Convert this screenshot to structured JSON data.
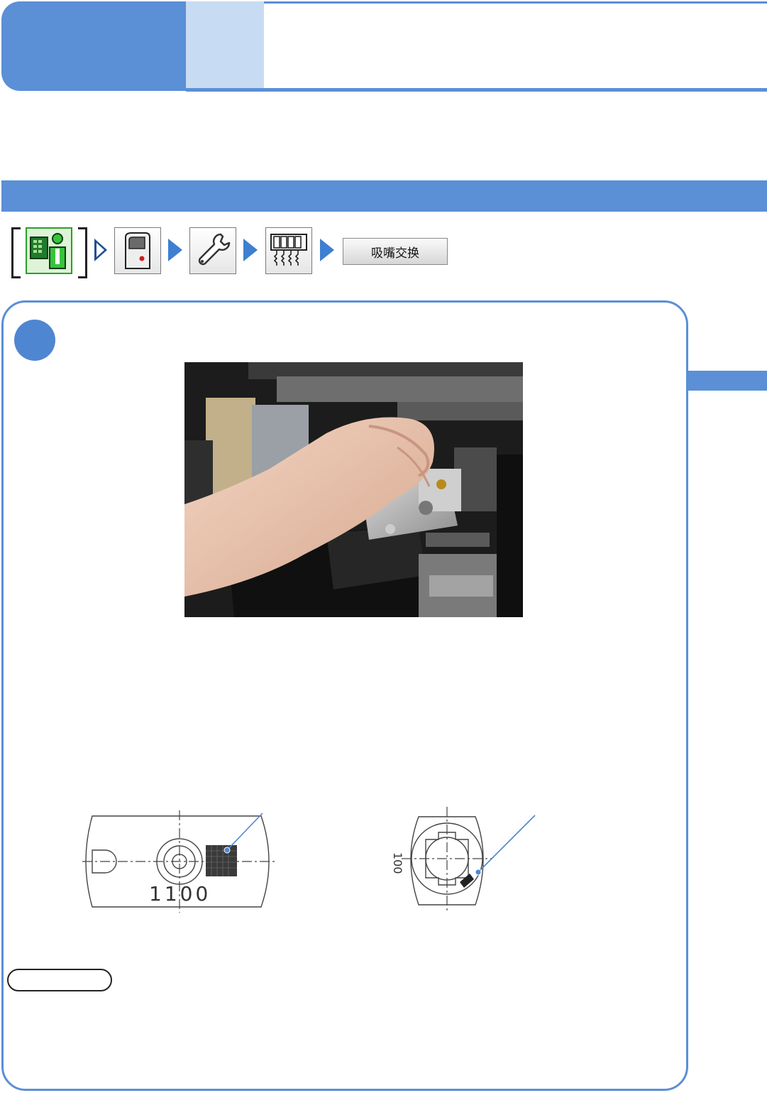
{
  "navigation": {
    "icons": [
      "operator-icon",
      "machine-icon",
      "wrench-icon",
      "nozzle-set-icon"
    ],
    "button_label": "吸嘴交换"
  },
  "drawings": {
    "left_label": "1100",
    "right_label": "100"
  },
  "colors": {
    "accent": "#5b8fd6",
    "accent_light": "#c7dbf3",
    "arrow": "#3d7fd1"
  }
}
